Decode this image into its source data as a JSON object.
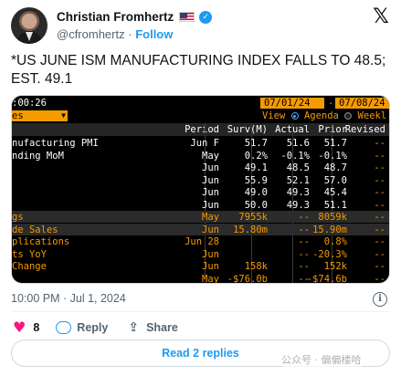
{
  "author": {
    "name": "Christian Fromhertz",
    "handle": "@cfromhertz",
    "separator": "·",
    "follow_label": "Follow",
    "flag_icon": "us-flag-icon",
    "verified_icon": "verified-badge-icon"
  },
  "tweet": {
    "text": "*US JUNE ISM MANUFACTURING INDEX FALLS TO 48.5; EST. 49.1"
  },
  "terminal": {
    "time": ":00:26",
    "date_from": "07/01/24",
    "date_dash": "-",
    "date_to": "07/08/24",
    "select_value": "es",
    "view_label": "View",
    "agenda_label": "Agenda",
    "weekly_label": "Weekl",
    "columns": {
      "name": "",
      "period": "Period",
      "surv": "Surv(M)",
      "actual": "Actual",
      "prior": "Prior",
      "revised": "Revised"
    },
    "rows": [
      {
        "name": "nufacturing PMI",
        "period": "Jun F",
        "surv": "51.7",
        "actual": "51.6",
        "prior": "51.7",
        "revised": "--",
        "hl": false,
        "color": "white"
      },
      {
        "name": "nding MoM",
        "period": "May",
        "surv": "0.2%",
        "actual": "-0.1%",
        "prior": "-0.1%",
        "revised": "--",
        "hl": false,
        "color": "white"
      },
      {
        "name": "",
        "period": "Jun",
        "surv": "49.1",
        "actual": "48.5",
        "prior": "48.7",
        "revised": "--",
        "hl": false,
        "color": "white"
      },
      {
        "name": "",
        "period": "Jun",
        "surv": "55.9",
        "actual": "52.1",
        "prior": "57.0",
        "revised": "--",
        "hl": false,
        "color": "white"
      },
      {
        "name": "",
        "period": "Jun",
        "surv": "49.0",
        "actual": "49.3",
        "prior": "45.4",
        "revised": "--",
        "hl": false,
        "color": "white"
      },
      {
        "name": "",
        "period": "Jun",
        "surv": "50.0",
        "actual": "49.3",
        "prior": "51.1",
        "revised": "--",
        "hl": false,
        "color": "white"
      },
      {
        "name": "gs",
        "period": "May",
        "surv": "7955k",
        "actual": "--",
        "prior": "8059k",
        "revised": "--",
        "hl": true,
        "color": "orange"
      },
      {
        "name": "de Sales",
        "period": "Jun",
        "surv": "15.80m",
        "actual": "--",
        "prior": "15.90m",
        "revised": "--",
        "hl": true,
        "color": "orange"
      },
      {
        "name": "plications",
        "period": "Jun 28",
        "surv": "",
        "actual": "--",
        "prior": "0.8%",
        "revised": "--",
        "hl": false,
        "color": "orange"
      },
      {
        "name": "ts YoY",
        "period": "Jun",
        "surv": "",
        "actual": "--",
        "prior": "-20.3%",
        "revised": "--",
        "hl": false,
        "color": "orange"
      },
      {
        "name": "Change",
        "period": "Jun",
        "surv": "158k",
        "actual": "--",
        "prior": "152k",
        "revised": "--",
        "hl": false,
        "color": "orange"
      },
      {
        "name": "",
        "period": "May",
        "surv": "-$76.0b",
        "actual": "--",
        "prior": "-$74.6b",
        "revised": "--",
        "hl": false,
        "color": "orange"
      }
    ]
  },
  "meta": {
    "timestamp": "10:00 PM · Jul 1, 2024",
    "info_icon": "info-icon"
  },
  "actions": {
    "like_count": "8",
    "reply_label": "Reply",
    "share_label": "Share",
    "read_replies_label": "Read 2 replies"
  },
  "watermark": "公众号 · 偏偏楼哈"
}
